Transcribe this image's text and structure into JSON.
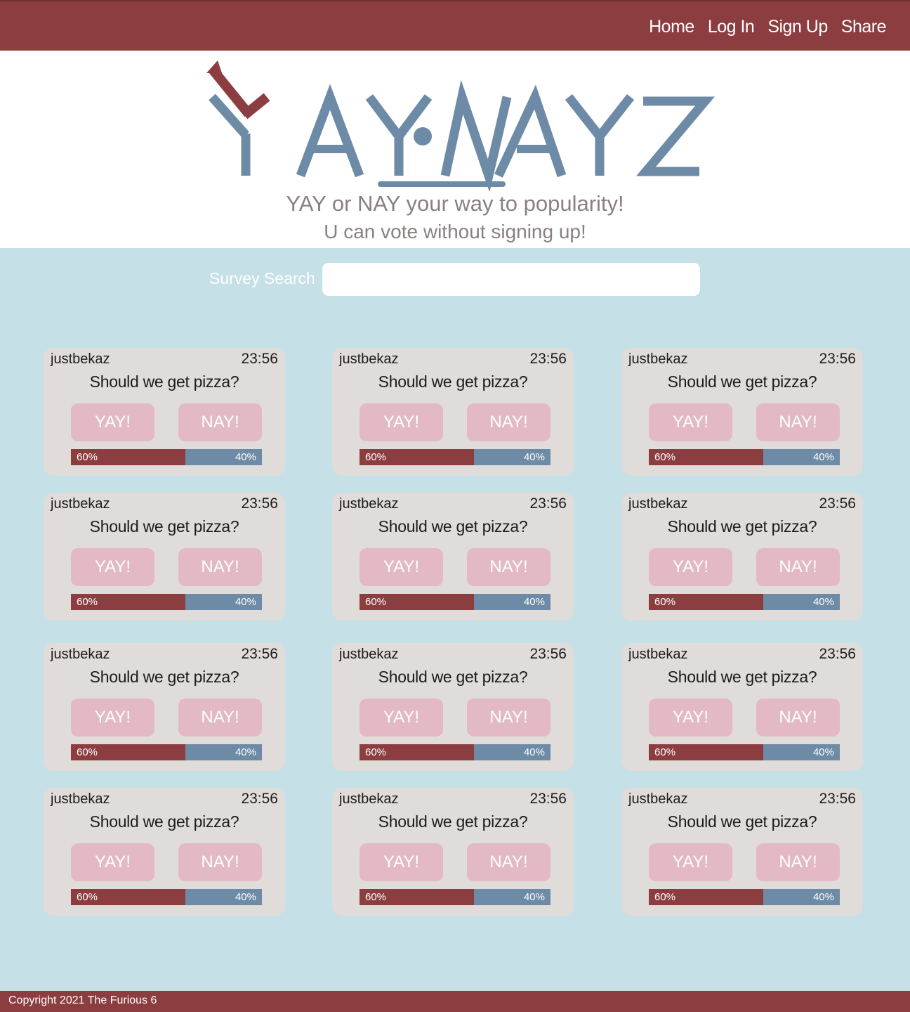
{
  "nav": {
    "links": [
      "Home",
      "Log In",
      "Sign Up",
      "Share"
    ]
  },
  "hero": {
    "logo_text": "YAY·NAYZ",
    "tagline": "YAY or NAY your way to popularity!",
    "subtagline": "U can vote without signing up!"
  },
  "search": {
    "label": "Survey Search",
    "placeholder": ""
  },
  "colors": {
    "brand_red": "#8c3d40",
    "brand_blue": "#6d8aa6",
    "background_blue": "#c5e0e6",
    "card_gray": "#e0dcda",
    "button_pink": "#e2b9c4"
  },
  "surveys": [
    {
      "user": "justbekaz",
      "time": "23:56",
      "question": "Should we get pizza?",
      "yay_label": "YAY!",
      "nay_label": "NAY!",
      "yay_percent": 60,
      "nay_percent": 40,
      "yay_text": "60%",
      "nay_text": "40%"
    },
    {
      "user": "justbekaz",
      "time": "23:56",
      "question": "Should we get pizza?",
      "yay_label": "YAY!",
      "nay_label": "NAY!",
      "yay_percent": 60,
      "nay_percent": 40,
      "yay_text": "60%",
      "nay_text": "40%"
    },
    {
      "user": "justbekaz",
      "time": "23:56",
      "question": "Should we get pizza?",
      "yay_label": "YAY!",
      "nay_label": "NAY!",
      "yay_percent": 60,
      "nay_percent": 40,
      "yay_text": "60%",
      "nay_text": "40%"
    },
    {
      "user": "justbekaz",
      "time": "23:56",
      "question": "Should we get pizza?",
      "yay_label": "YAY!",
      "nay_label": "NAY!",
      "yay_percent": 60,
      "nay_percent": 40,
      "yay_text": "60%",
      "nay_text": "40%"
    },
    {
      "user": "justbekaz",
      "time": "23:56",
      "question": "Should we get pizza?",
      "yay_label": "YAY!",
      "nay_label": "NAY!",
      "yay_percent": 60,
      "nay_percent": 40,
      "yay_text": "60%",
      "nay_text": "40%"
    },
    {
      "user": "justbekaz",
      "time": "23:56",
      "question": "Should we get pizza?",
      "yay_label": "YAY!",
      "nay_label": "NAY!",
      "yay_percent": 60,
      "nay_percent": 40,
      "yay_text": "60%",
      "nay_text": "40%"
    },
    {
      "user": "justbekaz",
      "time": "23:56",
      "question": "Should we get pizza?",
      "yay_label": "YAY!",
      "nay_label": "NAY!",
      "yay_percent": 60,
      "nay_percent": 40,
      "yay_text": "60%",
      "nay_text": "40%"
    },
    {
      "user": "justbekaz",
      "time": "23:56",
      "question": "Should we get pizza?",
      "yay_label": "YAY!",
      "nay_label": "NAY!",
      "yay_percent": 60,
      "nay_percent": 40,
      "yay_text": "60%",
      "nay_text": "40%"
    },
    {
      "user": "justbekaz",
      "time": "23:56",
      "question": "Should we get pizza?",
      "yay_label": "YAY!",
      "nay_label": "NAY!",
      "yay_percent": 60,
      "nay_percent": 40,
      "yay_text": "60%",
      "nay_text": "40%"
    },
    {
      "user": "justbekaz",
      "time": "23:56",
      "question": "Should we get pizza?",
      "yay_label": "YAY!",
      "nay_label": "NAY!",
      "yay_percent": 60,
      "nay_percent": 40,
      "yay_text": "60%",
      "nay_text": "40%"
    },
    {
      "user": "justbekaz",
      "time": "23:56",
      "question": "Should we get pizza?",
      "yay_label": "YAY!",
      "nay_label": "NAY!",
      "yay_percent": 60,
      "nay_percent": 40,
      "yay_text": "60%",
      "nay_text": "40%"
    },
    {
      "user": "justbekaz",
      "time": "23:56",
      "question": "Should we get pizza?",
      "yay_label": "YAY!",
      "nay_label": "NAY!",
      "yay_percent": 60,
      "nay_percent": 40,
      "yay_text": "60%",
      "nay_text": "40%"
    }
  ],
  "footer": {
    "copyright": "Copyright 2021 The Furious 6"
  }
}
